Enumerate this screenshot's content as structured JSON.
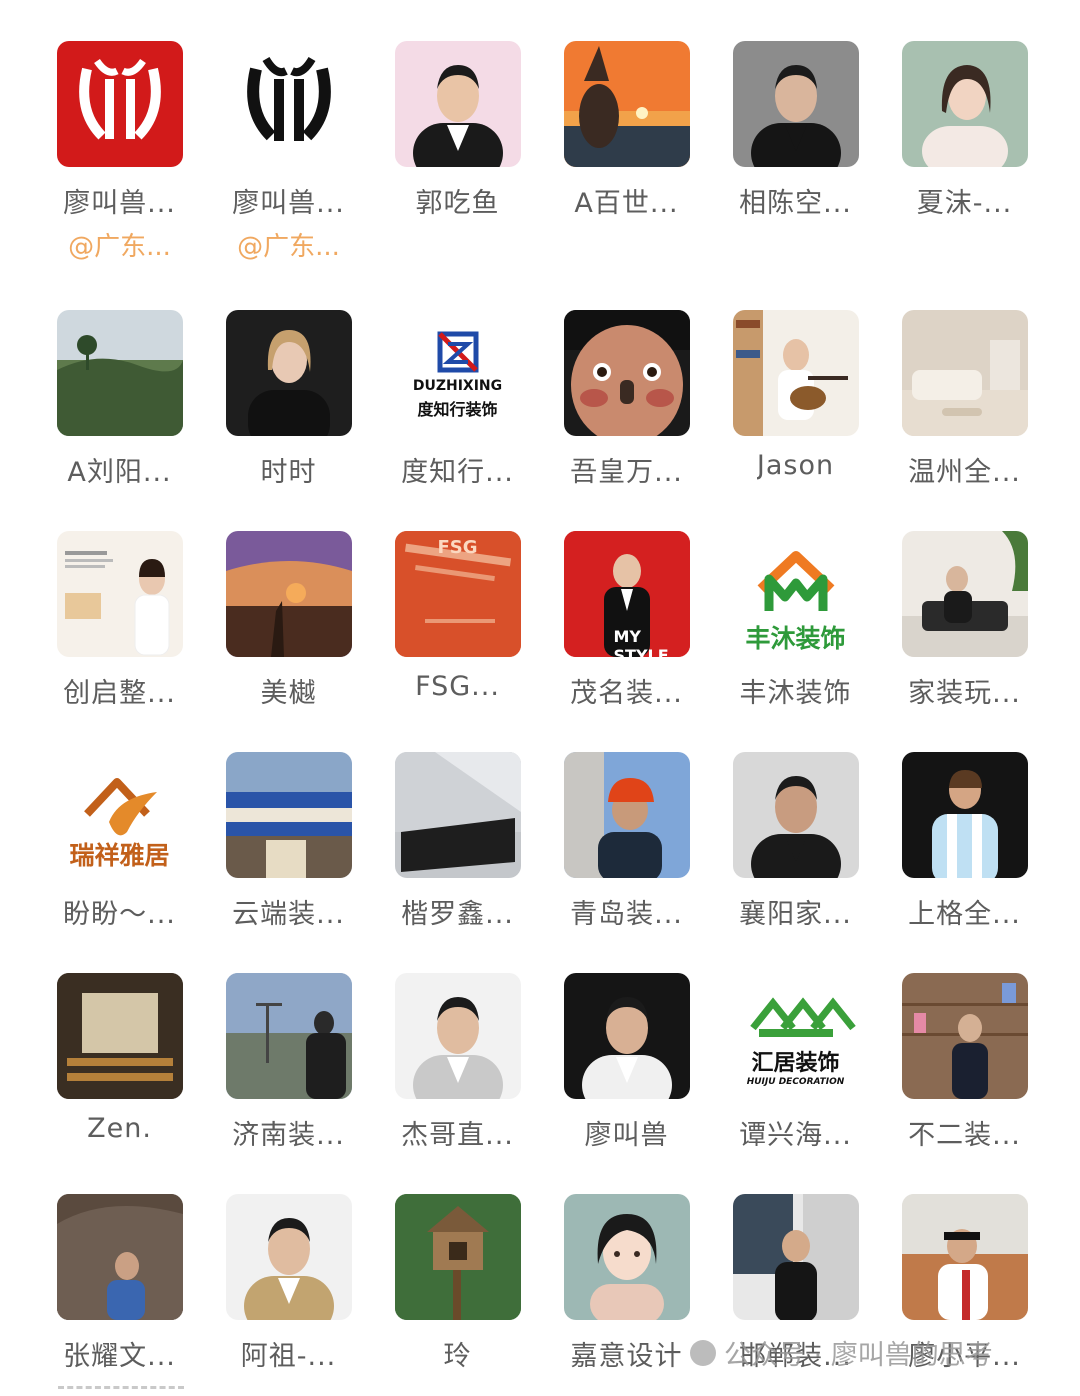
{
  "members": [
    {
      "name": "廖叫兽...",
      "subname": "@广东...",
      "avatar": "logo-red-icon"
    },
    {
      "name": "廖叫兽...",
      "subname": "@广东...",
      "avatar": "logo-black-icon"
    },
    {
      "name": "郭吃鱼",
      "avatar": "portrait-suit-icon"
    },
    {
      "name": "A百世...",
      "avatar": "sunset-photo-icon"
    },
    {
      "name": "相陈空...",
      "avatar": "portrait-dark-icon"
    },
    {
      "name": "夏沫-...",
      "avatar": "portrait-woman-icon"
    },
    {
      "name": "A刘阳...",
      "avatar": "landscape-icon"
    },
    {
      "name": "时时",
      "avatar": "portrait-woman-dark-icon"
    },
    {
      "name": "度知行...",
      "avatar": "duzhixing-logo-icon",
      "logo_en": "DUZHIXING",
      "logo_cn": "度知行装饰"
    },
    {
      "name": "吾皇万...",
      "avatar": "child-face-icon"
    },
    {
      "name": "Jason",
      "avatar": "guitar-photo-icon"
    },
    {
      "name": "温州全...",
      "avatar": "living-room-icon"
    },
    {
      "name": "创启整...",
      "avatar": "poster-woman-icon"
    },
    {
      "name": "美樾",
      "avatar": "sunset-hand-icon"
    },
    {
      "name": "FSG...",
      "avatar": "fsg-wall-icon",
      "logo_en": "FSG"
    },
    {
      "name": "茂名装...",
      "avatar": "mystyle-poster-icon",
      "logo_en": "MY STYLE"
    },
    {
      "name": "丰沐装饰",
      "avatar": "fengmu-logo-icon",
      "logo_cn": "丰沐装饰"
    },
    {
      "name": "家装玩...",
      "avatar": "office-sofa-icon"
    },
    {
      "name": "盼盼～...",
      "avatar": "ruixiang-logo-icon",
      "logo_cn": "瑞祥雅居"
    },
    {
      "name": "云端装...",
      "avatar": "storefront-icon"
    },
    {
      "name": "楷罗鑫...",
      "avatar": "reception-desk-icon"
    },
    {
      "name": "青岛装...",
      "avatar": "hardhat-man-icon"
    },
    {
      "name": "襄阳家...",
      "avatar": "portrait-man-icon"
    },
    {
      "name": "上格全...",
      "avatar": "football-player-icon"
    },
    {
      "name": "Zen.",
      "avatar": "interior-hall-icon"
    },
    {
      "name": "济南装...",
      "avatar": "city-view-icon"
    },
    {
      "name": "杰哥直...",
      "avatar": "pointing-man-icon"
    },
    {
      "name": "廖叫兽",
      "avatar": "speaker-man-icon"
    },
    {
      "name": "谭兴海...",
      "avatar": "huiju-logo-icon",
      "logo_cn": "汇居装饰",
      "logo_en": "HUIJU DECORATION"
    },
    {
      "name": "不二装...",
      "avatar": "shelf-man-icon"
    },
    {
      "name": "张耀文...",
      "avatar": "elephant-photo-icon"
    },
    {
      "name": "阿祖-...",
      "avatar": "jacket-man-icon"
    },
    {
      "name": "玲",
      "avatar": "treehouse-icon"
    },
    {
      "name": "嘉意设计",
      "avatar": "anime-girl-icon"
    },
    {
      "name": "邯郸装...",
      "avatar": "portrait-door-icon"
    },
    {
      "name": "廖小平...",
      "avatar": "mic-man-icon"
    }
  ],
  "watermark": {
    "text": "公众号 · 廖叫兽的思考"
  },
  "colors": {
    "name": "#5d5d5d",
    "subname": "#f0a860",
    "brand_red": "#d21a1a",
    "brand_green": "#2e9a3a",
    "brand_orange": "#e06a1a"
  }
}
